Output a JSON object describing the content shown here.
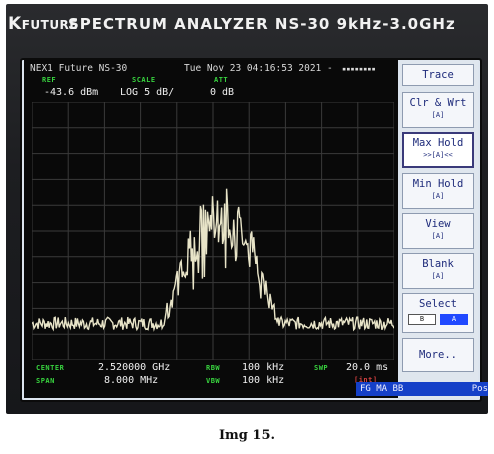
{
  "brand": {
    "logo_k": "K",
    "logo_word": "FUTURE",
    "title": "SPECTRUM ANALYZER NS-30  9kHz-3.0GHz"
  },
  "header": {
    "device": "NEX1 Future NS-30",
    "datetime": "Tue Nov 23 04:16:53 2021 -",
    "dashes": "▪▪▪▪▪▪▪▪"
  },
  "settings": {
    "ref_label": "REF",
    "ref_value": "-43.6 dBm",
    "scale_label": "SCALE",
    "scale_value": "LOG  5 dB/",
    "att_label": "ATT",
    "att_value": "0 dB"
  },
  "footer": {
    "center_label": "CENTER",
    "center_value": "2.520000 GHz",
    "span_label": "SPAN",
    "span_value": "8.000 MHz",
    "rbw_label": "RBW",
    "rbw_value": "100 kHz",
    "vbw_label": "VBW",
    "vbw_value": "100 kHz",
    "swp_label": "SWP",
    "swp_value": "20.0 ms",
    "swp_mode": "[int]"
  },
  "status": {
    "mode": "FG MA BB",
    "pos": "Pos"
  },
  "softkeys": {
    "trace": "Trace",
    "clr_wrt": "Clr & Wrt",
    "clr_wrt_sub": "[A]",
    "max_hold": "Max  Hold",
    "max_hold_sub": ">>[A]<<",
    "min_hold": "Min  Hold",
    "min_hold_sub": "[A]",
    "view": "View",
    "view_sub": "[A]",
    "blank": "Blank",
    "blank_sub": "[A]",
    "select": "Select",
    "select_b": "B",
    "select_a": "A",
    "more": "More.."
  },
  "spectrum": {
    "center_ghz": 2.52,
    "span_mhz": 8.0,
    "ref_dbm": -43.6,
    "scale_db_per_div": 5,
    "divisions": 10,
    "noise_floor_dbm": -86.5,
    "peak_dbm": -58.5,
    "trace_color": "#e8e4c8",
    "grid_color": "#3a3a3a"
  },
  "caption": "Img 15."
}
